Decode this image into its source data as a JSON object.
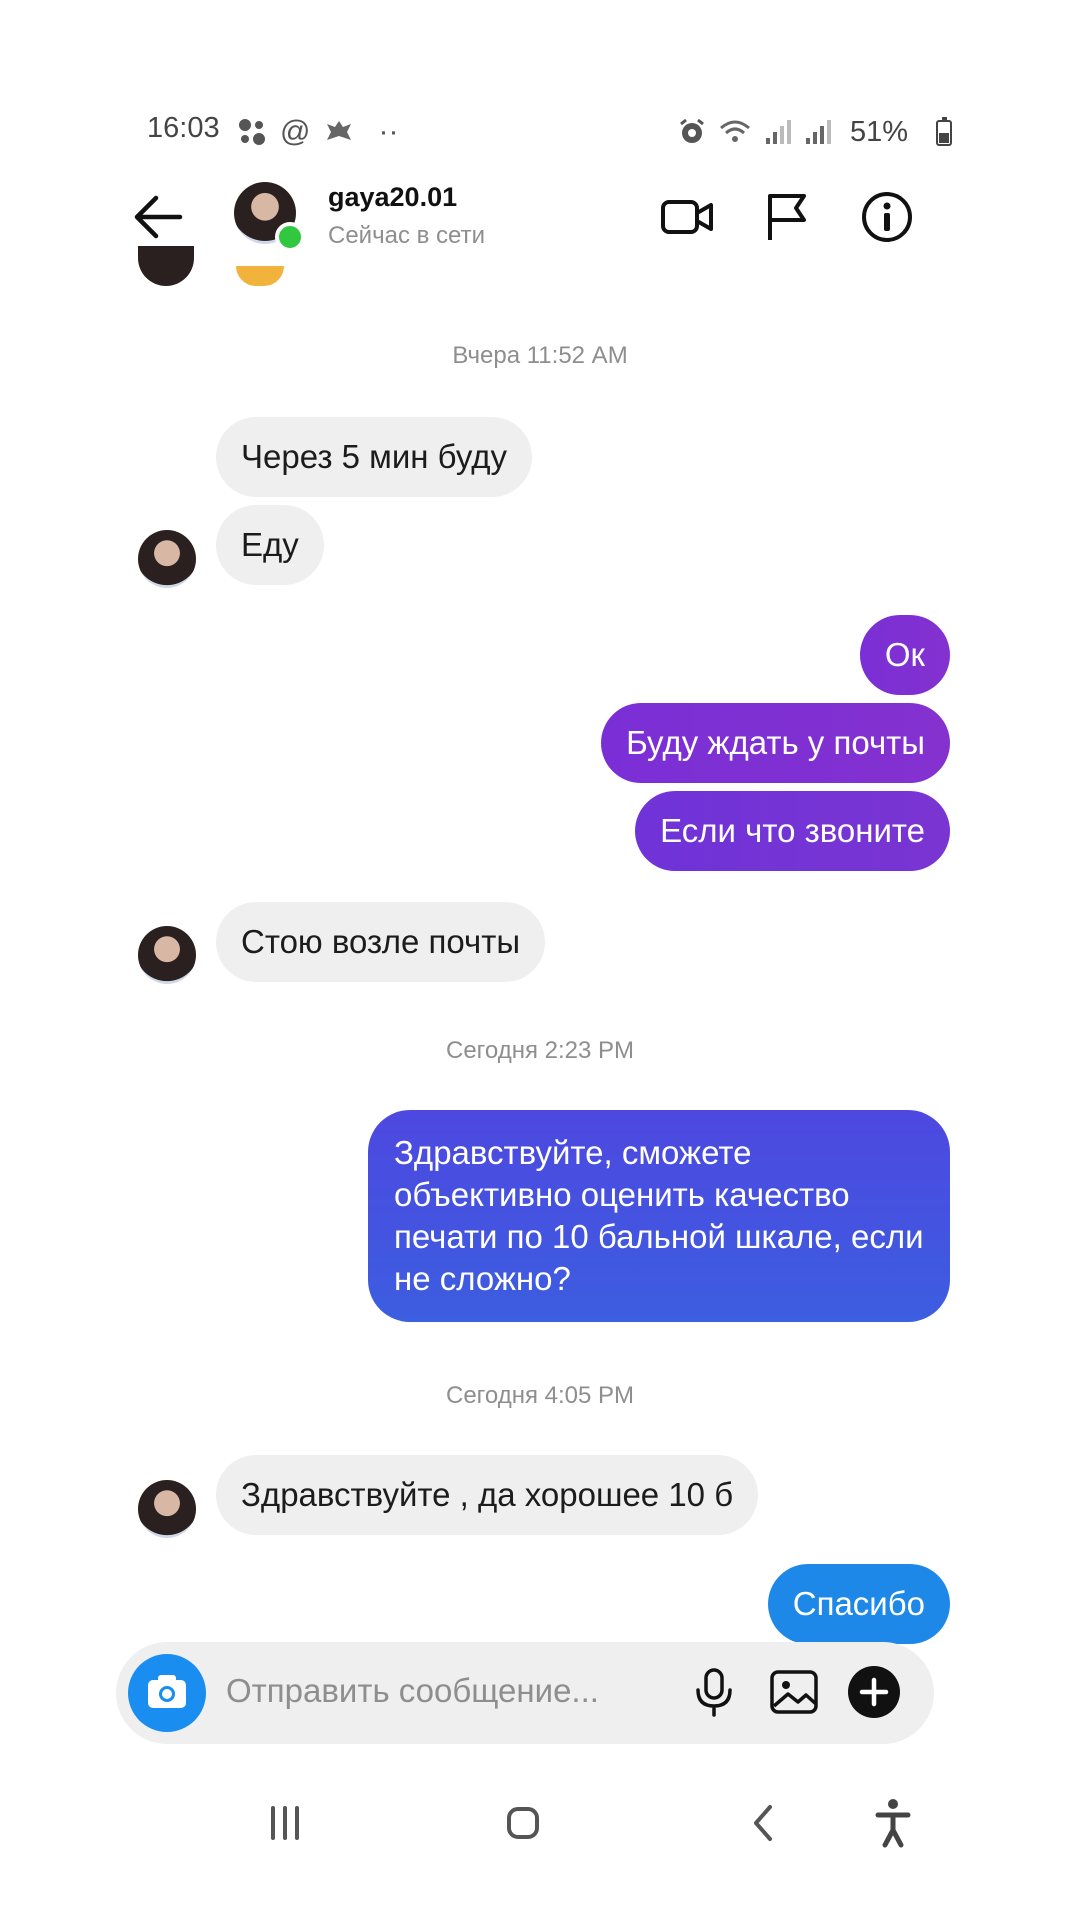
{
  "status_bar": {
    "time": "16:03",
    "battery": "51%"
  },
  "header": {
    "username": "gaya20.01",
    "presence": "Сейчас в сети"
  },
  "composer": {
    "placeholder": "Отправить сообщение..."
  },
  "conversation": {
    "timestamps": [
      "Вчера 11:52 AM",
      "Сегодня 2:23 PM",
      "Сегодня 4:05 PM"
    ],
    "messages": [
      {
        "from": "contact",
        "text": "Через 5 мин буду"
      },
      {
        "from": "contact",
        "text": "Еду"
      },
      {
        "from": "me",
        "text": "Ок"
      },
      {
        "from": "me",
        "text": "Буду ждать у почты"
      },
      {
        "from": "me",
        "text": "Если что звоните"
      },
      {
        "from": "contact",
        "text": "Стою возле почты"
      },
      {
        "from": "me",
        "text": "Здравствуйте, сможете объективно оценить качество печати по 10 бальной шкале, если не сложно?"
      },
      {
        "from": "contact",
        "text": "Здравствуйте , да хорошее 10 б"
      },
      {
        "from": "me",
        "text": "Спасибо"
      }
    ]
  },
  "colors": {
    "outgoing_purple": "#7a2fd6",
    "outgoing_blue": "#4454e0",
    "outgoing_cyan": "#1e88e8",
    "incoming": "#efefef",
    "online": "#31c840"
  },
  "icons": {
    "header": [
      "back-arrow-icon",
      "video-call-icon",
      "flag-icon",
      "info-icon"
    ],
    "composer": [
      "camera-icon",
      "microphone-icon",
      "gallery-icon",
      "plus-icon"
    ],
    "navigation": [
      "recent-apps-icon",
      "home-icon",
      "back-icon",
      "accessibility-icon"
    ]
  }
}
